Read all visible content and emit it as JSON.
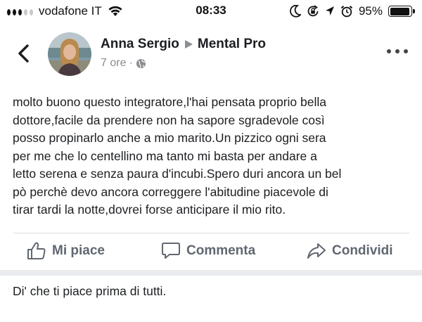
{
  "status_bar": {
    "carrier": "vodafone IT",
    "time": "08:33",
    "battery_percent": "95%",
    "battery_level": 0.95,
    "signal_bars_filled": 3,
    "signal_bars_total": 5,
    "icons": [
      "wifi-icon",
      "moon-icon",
      "orientation-lock-icon",
      "location-icon",
      "alarm-icon",
      "battery-icon"
    ]
  },
  "header": {
    "back_icon": "chevron-left-icon",
    "author_name": "Anna Sergio",
    "target_page": "Mental Pro",
    "time_ago": "7 ore",
    "separator": "·",
    "privacy_icon": "globe-icon",
    "more_icon": "more-horizontal-icon"
  },
  "post": {
    "text": "molto buono questo integratore,l'hai pensata proprio bella\ndottore,facile da prendere non ha sapore sgradevole così\nposso propinarlo anche a mio marito.Un pizzico ogni sera\nper me che lo centellino ma tanto mi basta per andare a\nletto serena e senza paura d'incubi.Spero duri ancora un bel\npò perchè devo ancora correggere l'abitudine piacevole di\ntirar tardi la notte,dovrei forse anticipare il mio rito."
  },
  "actions": {
    "like_label": "Mi piace",
    "comment_label": "Commenta",
    "share_label": "Condividi"
  },
  "footer": {
    "first_like_prompt": "Di' che ti piace prima di tutti."
  },
  "colors": {
    "text": "#1c1e21",
    "secondary_text": "#8a8d91",
    "action_text": "#606770",
    "divider": "#dadde1",
    "band": "#e9ebee"
  }
}
